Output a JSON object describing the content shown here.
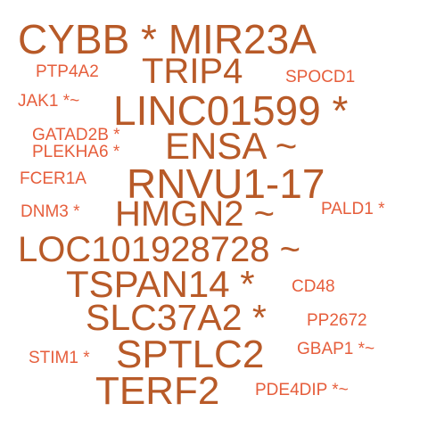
{
  "colors": {
    "background": "#ffffff",
    "large_word": "#b85a28",
    "small_word": "#e65e3c"
  },
  "words": {
    "cybb": "CYBB * MIR23A",
    "trip4": "TRIP4",
    "ptp4a2": "PTP4A2",
    "spocd1": "SPOCD1",
    "jak1": "JAK1 *~",
    "linc01599": "LINC01599 *",
    "gatad2b": "GATAD2B *",
    "plekha6": "PLEKHA6 *",
    "ensa": "ENSA ~",
    "fcer1a": "FCER1A",
    "rnvu1_17": "RNVU1-17",
    "dnm3": "DNM3 *",
    "hmgn2": "HMGN2 ~",
    "pald1": "PALD1 *",
    "loc101928728": "LOC101928728 ~",
    "tspan14": "TSPAN14 *",
    "cd48": "CD48",
    "slc37a2": "SLC37A2 *",
    "pp2672": "PP2672",
    "gbap1": "GBAP1 *~",
    "stim1": "STIM1 *",
    "sptlc2": "SPTLC2",
    "terf2": "TERF2",
    "pde4dip": "PDE4DIP *~"
  }
}
